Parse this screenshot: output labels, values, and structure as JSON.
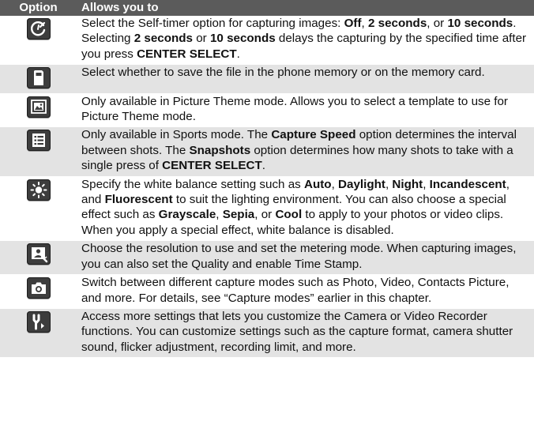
{
  "header": {
    "col_option": "Option",
    "col_allows": "Allows you to"
  },
  "rows": [
    {
      "icon": "self-timer-icon",
      "text": [
        {
          "t": "Select the Self-timer option for capturing images: "
        },
        {
          "t": "Off",
          "b": true
        },
        {
          "t": ", "
        },
        {
          "t": "2 seconds",
          "b": true
        },
        {
          "t": ", or "
        },
        {
          "t": "10 seconds",
          "b": true
        },
        {
          "t": ". Selecting "
        },
        {
          "t": "2 seconds",
          "b": true
        },
        {
          "t": " or "
        },
        {
          "t": "10 seconds",
          "b": true
        },
        {
          "t": " delays the capturing by the specified time after you press "
        },
        {
          "t": "CENTER SELECT",
          "b": true
        },
        {
          "t": "."
        }
      ]
    },
    {
      "icon": "storage-card-icon",
      "text": [
        {
          "t": "Select whether to save the file in the phone memory or on the memory card."
        }
      ]
    },
    {
      "icon": "picture-theme-icon",
      "text": [
        {
          "t": "Only available in Picture Theme mode. Allows you to select a template to use for Picture Theme mode."
        }
      ]
    },
    {
      "icon": "sports-list-icon",
      "text": [
        {
          "t": "Only available in Sports mode. The "
        },
        {
          "t": "Capture Speed",
          "b": true
        },
        {
          "t": " option determines the interval between shots. The "
        },
        {
          "t": "Snapshots",
          "b": true
        },
        {
          "t": " option determines how many shots to take with a single press of "
        },
        {
          "t": "CENTER SELECT",
          "b": true
        },
        {
          "t": "."
        }
      ]
    },
    {
      "icon": "brightness-sun-icon",
      "text": [
        {
          "t": "Specify the white balance setting such as "
        },
        {
          "t": "Auto",
          "b": true
        },
        {
          "t": ", "
        },
        {
          "t": "Daylight",
          "b": true
        },
        {
          "t": ", "
        },
        {
          "t": "Night",
          "b": true
        },
        {
          "t": ", "
        },
        {
          "t": "Incandescent",
          "b": true
        },
        {
          "t": ", and "
        },
        {
          "t": "Fluorescent",
          "b": true
        },
        {
          "t": " to suit the lighting environment. You can also choose a special effect such as "
        },
        {
          "t": "Grayscale",
          "b": true
        },
        {
          "t": ", "
        },
        {
          "t": "Sepia",
          "b": true
        },
        {
          "t": ", or "
        },
        {
          "t": "Cool",
          "b": true
        },
        {
          "t": " to apply to your photos or video clips. When you apply a special effect, white balance is disabled."
        }
      ]
    },
    {
      "icon": "resolution-settings-icon",
      "text": [
        {
          "t": "Choose the resolution to use and set the metering mode. When capturing images, you can also set the Quality and enable Time Stamp."
        }
      ]
    },
    {
      "icon": "camera-icon",
      "text": [
        {
          "t": "Switch between different capture modes such as Photo, Video, Contacts Picture, and more. For details, see “Capture modes” earlier in this chapter."
        }
      ]
    },
    {
      "icon": "tools-settings-icon",
      "text": [
        {
          "t": "Access more settings that lets you customize the Camera or Video Recorder functions. You can customize settings such as the capture format, camera shutter sound, flicker adjustment, recording limit, and more."
        }
      ]
    }
  ]
}
